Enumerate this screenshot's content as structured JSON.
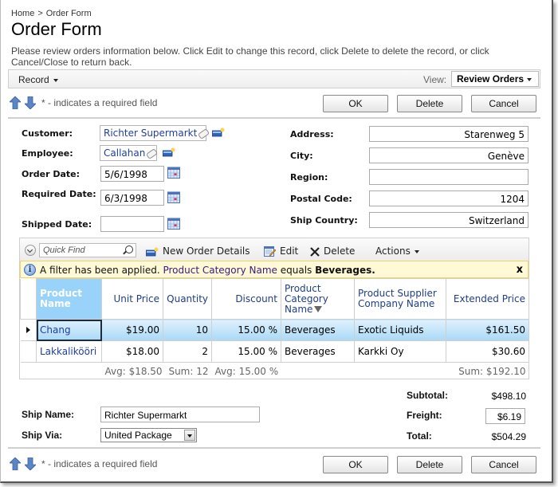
{
  "breadcrumb": {
    "home": "Home",
    "separator": ">",
    "current": "Order Form"
  },
  "page": {
    "title": "Order Form",
    "description": "Please review orders information below. Click Edit to change this record, click Delete to delete the record, or click Cancel/Close to return back."
  },
  "toolbar": {
    "record_menu": "Record",
    "view_label": "View:",
    "view_value": "Review Orders"
  },
  "actions": {
    "required_note": "* - indicates a required field",
    "ok": "OK",
    "delete": "Delete",
    "cancel": "Cancel"
  },
  "form": {
    "customer": {
      "label": "Customer:",
      "value": "Richter Supermarkt"
    },
    "employee": {
      "label": "Employee:",
      "value": "Callahan"
    },
    "order_date": {
      "label": "Order Date:",
      "value": "5/6/1998"
    },
    "required_date": {
      "label": "Required Date:",
      "value": "6/3/1998"
    },
    "shipped_date": {
      "label": "Shipped Date:",
      "value": ""
    },
    "address": {
      "label": "Address:",
      "value": "Starenweg 5"
    },
    "city": {
      "label": "City:",
      "value": "Genève"
    },
    "region": {
      "label": "Region:",
      "value": ""
    },
    "postal_code": {
      "label": "Postal Code:",
      "value": "1204"
    },
    "ship_country": {
      "label": "Ship Country:",
      "value": "Switzerland"
    }
  },
  "grid": {
    "quick_find_placeholder": "Quick Find",
    "new_button": "New Order Details",
    "edit_button": "Edit",
    "delete_button": "Delete",
    "actions_menu": "Actions",
    "filter_message": {
      "prefix": "A filter has been applied.",
      "field": "Product Category Name",
      "operator": "equals",
      "value": "Beverages."
    },
    "filter_close": "x",
    "columns": [
      "Product Name",
      "Unit Price",
      "Quantity",
      "Discount",
      "Product Category Name",
      "Product Supplier Company Name",
      "Extended Price"
    ],
    "rows": [
      {
        "product": "Chang",
        "unit_price": "$19.00",
        "quantity": "10",
        "discount": "15.00 %",
        "category": "Beverages",
        "supplier": "Exotic Liquids",
        "extended": "$161.50",
        "selected": true
      },
      {
        "product": "Lakkalikööri",
        "unit_price": "$18.00",
        "quantity": "2",
        "discount": "15.00 %",
        "category": "Beverages",
        "supplier": "Karkki Oy",
        "extended": "$30.60",
        "selected": false
      }
    ],
    "aggregates": {
      "unit_price": "Avg: $18.50",
      "quantity": "Sum: 12",
      "discount": "Avg: 15.00 %",
      "extended": "Sum: $192.10"
    }
  },
  "shipping": {
    "ship_name": {
      "label": "Ship Name:",
      "value": "Richter Supermarkt"
    },
    "ship_via": {
      "label": "Ship Via:",
      "value": "United Package"
    }
  },
  "totals": {
    "subtotal": {
      "label": "Subtotal:",
      "value": "$498.10"
    },
    "freight": {
      "label": "Freight:",
      "value": "$6.19"
    },
    "total": {
      "label": "Total:",
      "value": "$504.29"
    }
  },
  "colors": {
    "sorted_header": "#99d3fa",
    "selected_row": "#a9d8f6",
    "filter_bar": "#fff9d6",
    "link": "#1f3f9f"
  }
}
